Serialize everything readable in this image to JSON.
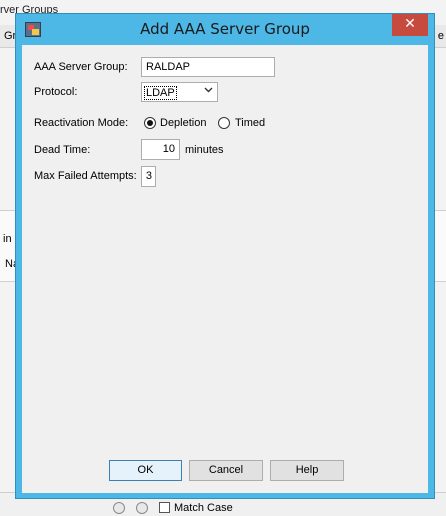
{
  "background": {
    "title": "rver Groups",
    "col_left": "Gr",
    "col_right": "e",
    "in_text": "in",
    "na_text": "Na",
    "match_case": "Match Case"
  },
  "dialog": {
    "title": "Add AAA Server Group",
    "close_glyph": "✕",
    "fields": {
      "server_group_label": "AAA Server Group:",
      "server_group_value": "RALDAP",
      "protocol_label": "Protocol:",
      "protocol_value": "LDAP",
      "reactivation_label": "Reactivation Mode:",
      "reactivation_options": [
        "Depletion",
        "Timed"
      ],
      "reactivation_selected": "Depletion",
      "dead_time_label": "Dead Time:",
      "dead_time_value": "10",
      "dead_time_unit": "minutes",
      "max_failed_label": "Max Failed Attempts:",
      "max_failed_value": "3"
    },
    "buttons": {
      "ok": "OK",
      "cancel": "Cancel",
      "help": "Help"
    }
  },
  "icons": {
    "dialog_icon": "app-window-icon",
    "select_chevron": "chevron-down-icon"
  },
  "colors": {
    "titlebar": "#4db7e6",
    "close_button": "#c74a3e",
    "client_bg": "#f0f0f0",
    "default_button_border": "#3c7fb1"
  }
}
